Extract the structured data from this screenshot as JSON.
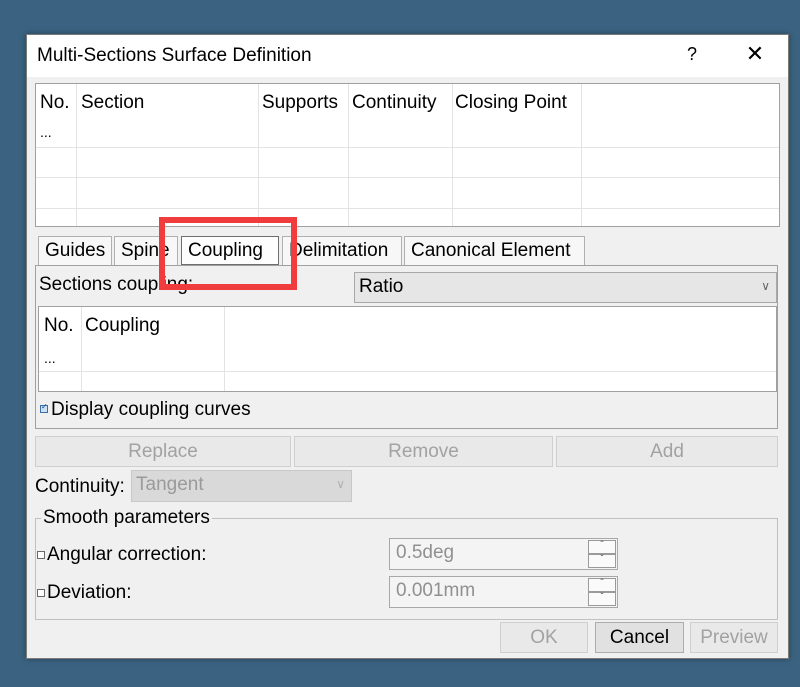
{
  "dialog": {
    "title": "Multi-Sections Surface Definition",
    "help_label": "?",
    "close_label": "✕"
  },
  "sections_table": {
    "columns": [
      "No.",
      "Section",
      "Supports",
      "Continuity",
      "Closing Point"
    ],
    "rows": [
      [
        "..."
      ]
    ]
  },
  "tabs": [
    {
      "label": "Guides",
      "active": false
    },
    {
      "label": "Spine",
      "active": false
    },
    {
      "label": "Coupling",
      "active": true
    },
    {
      "label": "Delimitation",
      "active": false
    },
    {
      "label": "Canonical Element",
      "active": false
    }
  ],
  "coupling_panel": {
    "sections_coupling_label": "Sections coupling:",
    "sections_coupling_value": "Ratio",
    "coupling_table": {
      "columns": [
        "No.",
        "Coupling"
      ],
      "rows": [
        [
          "..."
        ]
      ]
    },
    "display_coupling_curves_label": "Display coupling curves",
    "display_coupling_curves_checked": true
  },
  "buttons": {
    "replace": "Replace",
    "remove": "Remove",
    "add": "Add"
  },
  "continuity": {
    "label": "Continuity:",
    "value": "Tangent"
  },
  "smooth_parameters": {
    "title": "Smooth parameters",
    "angular_correction_label": "Angular correction:",
    "angular_correction_value": "0.5deg",
    "angular_correction_checked": false,
    "deviation_label": "Deviation:",
    "deviation_value": "0.001mm",
    "deviation_checked": false
  },
  "footer": {
    "ok": "OK",
    "cancel": "Cancel",
    "preview": "Preview"
  },
  "colors": {
    "background": "#3b6381",
    "highlight": "#f03c3c"
  }
}
